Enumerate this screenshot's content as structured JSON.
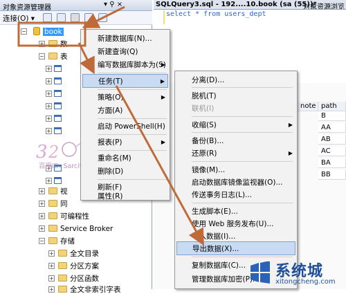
{
  "explorer": {
    "title": "对象资源管理器",
    "title_controls": "▾ ⚲ ×",
    "connect_label": "连接(O) ▾",
    "tree": {
      "database": "book",
      "nodes_hidden": [
        "数",
        "表",
        "视",
        "同"
      ],
      "programmability": "可编程性",
      "service_broker": "Service Broker",
      "storage": "存储",
      "storage_children": [
        "全文目录",
        "分区方案",
        "分区函数",
        "全文非索引字表"
      ]
    }
  },
  "editor": {
    "tab_title": "SQLQuery3.sql - 192....10.book (sa (55))*",
    "tab_other": "对象资源浏览",
    "sql": "select * from users_dept"
  },
  "results": {
    "columns": [
      "note",
      "path"
    ],
    "path_values": [
      "B",
      "AA",
      "AB",
      "AC",
      "BA",
      "BB"
    ]
  },
  "menu1": {
    "items": [
      {
        "label": "新建数据库(N)...",
        "sub": false
      },
      {
        "label": "新建查询(Q)",
        "sub": false
      },
      {
        "label": "编写数据库脚本为(S)",
        "sub": true
      },
      {
        "label": "任务(T)",
        "sub": true
      },
      {
        "label": "策略(O)",
        "sub": true
      },
      {
        "label": "方面(A)",
        "sub": false
      },
      {
        "label": "启动 PowerShell(H)",
        "sub": false
      },
      {
        "label": "报表(P)",
        "sub": true
      },
      {
        "label": "重命名(M)",
        "sub": false
      },
      {
        "label": "删除(D)",
        "sub": false
      },
      {
        "label": "刷新(F)",
        "sub": false
      },
      {
        "label": "属性(R)",
        "sub": false
      }
    ]
  },
  "menu2": {
    "items": [
      {
        "label": "分离(D)...",
        "sub": false,
        "disabled": false
      },
      {
        "label": "脱机(T)",
        "sub": false,
        "disabled": false
      },
      {
        "label": "联机(I)",
        "sub": false,
        "disabled": true
      },
      {
        "label": "收缩(S)",
        "sub": true,
        "disabled": false
      },
      {
        "label": "备份(B)...",
        "sub": false,
        "disabled": false
      },
      {
        "label": "还原(R)",
        "sub": true,
        "disabled": false
      },
      {
        "label": "镜像(M)...",
        "sub": false,
        "disabled": false
      },
      {
        "label": "启动数据库镜像监视器(O)...",
        "sub": false,
        "disabled": false
      },
      {
        "label": "传送事务日志(L)...",
        "sub": false,
        "disabled": false
      },
      {
        "label": "生成脚本(E)...",
        "sub": false,
        "disabled": false
      },
      {
        "label": "使用 Web 服务发布(U)...",
        "sub": false,
        "disabled": false
      },
      {
        "label": "导入数据(I)...",
        "sub": false,
        "disabled": false
      },
      {
        "label": "导出数据(X)...",
        "sub": false,
        "disabled": false
      },
      {
        "label": "复制数据库(C)...",
        "sub": false,
        "disabled": false
      },
      {
        "label": "管理数据库加密(P)...",
        "sub": false,
        "disabled": false
      }
    ]
  },
  "watermarks": {
    "left_id": "百度ID: Sarcitt",
    "right_cn": "系统城",
    "right_url": "xitongcheng.com"
  },
  "colors": {
    "annotation": "#c06a3a",
    "selection": "#3399ff",
    "menu_highlight": "#c9daf3"
  }
}
